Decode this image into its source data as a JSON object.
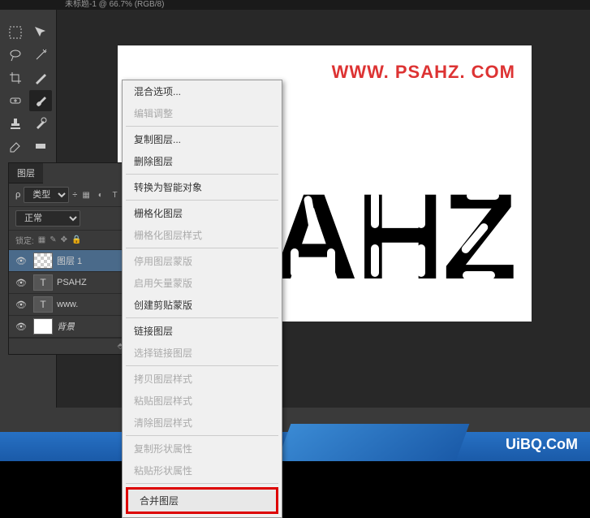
{
  "title": "未标题-1 @ 66.7% (RGB/8)",
  "watermark_top": "WWW. PSAHZ. COM",
  "watermark_bottom": "UiBQ.CoM",
  "canvas_text": "SAHZ",
  "layers_panel": {
    "tab": "图层",
    "type_label": "类型",
    "blend_mode": "正常",
    "lock_label": "锁定:",
    "layers": [
      {
        "name": "图层 1",
        "type": "checker"
      },
      {
        "name": "PSAHZ",
        "type": "T"
      },
      {
        "name": "www.",
        "type": "T"
      },
      {
        "name": "背景",
        "type": "solid"
      }
    ]
  },
  "context_menu": {
    "items": [
      {
        "label": "混合选项...",
        "enabled": true
      },
      {
        "label": "编辑调整",
        "enabled": false
      },
      {
        "sep": true
      },
      {
        "label": "复制图层...",
        "enabled": true
      },
      {
        "label": "删除图层",
        "enabled": true
      },
      {
        "sep": true
      },
      {
        "label": "转换为智能对象",
        "enabled": true
      },
      {
        "sep": true
      },
      {
        "label": "栅格化图层",
        "enabled": true
      },
      {
        "label": "栅格化图层样式",
        "enabled": false
      },
      {
        "sep": true
      },
      {
        "label": "停用图层蒙版",
        "enabled": false
      },
      {
        "label": "启用矢量蒙版",
        "enabled": false
      },
      {
        "label": "创建剪贴蒙版",
        "enabled": true
      },
      {
        "sep": true
      },
      {
        "label": "链接图层",
        "enabled": true
      },
      {
        "label": "选择链接图层",
        "enabled": false
      },
      {
        "sep": true
      },
      {
        "label": "拷贝图层样式",
        "enabled": false
      },
      {
        "label": "粘贴图层样式",
        "enabled": false
      },
      {
        "label": "清除图层样式",
        "enabled": false
      },
      {
        "sep": true
      },
      {
        "label": "复制形状属性",
        "enabled": false
      },
      {
        "label": "粘贴形状属性",
        "enabled": false
      },
      {
        "sep": true
      },
      {
        "label": "合并图层",
        "enabled": true,
        "highlight": true
      }
    ]
  }
}
